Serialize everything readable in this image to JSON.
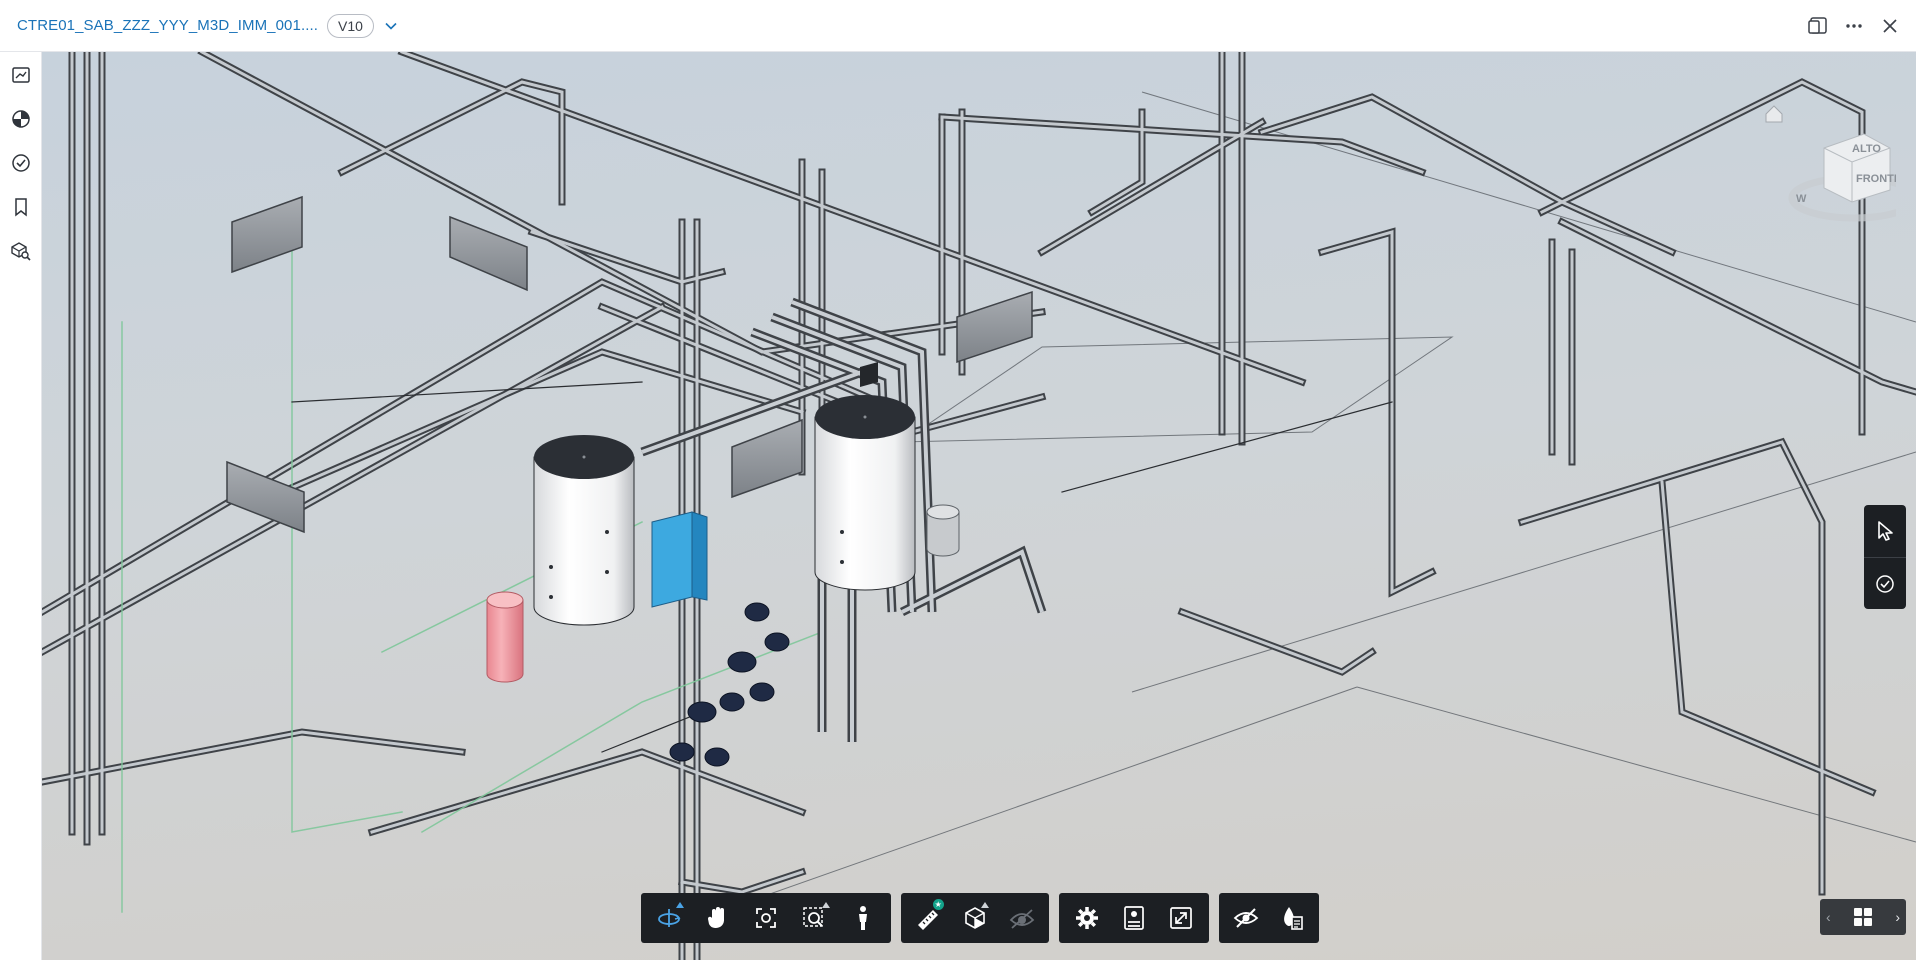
{
  "header": {
    "document_title": "CTRE01_SAB_ZZZ_YYY_M3D_IMM_001....",
    "version": "V10",
    "icons": [
      "version-dropdown-icon",
      "split-view-icon",
      "more-options-icon",
      "close-icon"
    ]
  },
  "left_rail": {
    "items": [
      {
        "name": "sheets-views",
        "icon": "sheets-icon"
      },
      {
        "name": "appearance",
        "icon": "palette-icon"
      },
      {
        "name": "issues",
        "icon": "check-circle-icon"
      },
      {
        "name": "bookmarks",
        "icon": "bookmark-icon"
      },
      {
        "name": "model-browser",
        "icon": "model-search-icon"
      }
    ]
  },
  "viewcube": {
    "top_label": "ALTO",
    "front_label": "FRONTE",
    "home_icon": "home-icon",
    "compass_label": "W"
  },
  "right_tools": {
    "items": [
      {
        "name": "select",
        "icon": "cursor-icon"
      },
      {
        "name": "markup-check",
        "icon": "check-circle-icon"
      }
    ]
  },
  "toolbar": {
    "groups": [
      {
        "name": "navigation",
        "items": [
          "orbit-icon",
          "pan-icon",
          "fit-view-icon",
          "zoom-window-icon",
          "first-person-icon"
        ]
      },
      {
        "name": "measure-section",
        "items": [
          "measure-icon",
          "section-box-icon",
          "explode-icon"
        ]
      },
      {
        "name": "settings",
        "items": [
          "settings-icon",
          "properties-icon",
          "fullscreen-icon"
        ]
      },
      {
        "name": "visibility",
        "items": [
          "hide-icon",
          "model-tree-icon"
        ]
      }
    ],
    "active_tool": "orbit-icon"
  },
  "pager": {
    "prev": "‹",
    "next": "›",
    "icon": "grid-icon"
  },
  "colors": {
    "accent": "#1a73b8",
    "toolbar_bg": "#1c1f23",
    "active_icon": "#4aa3e6",
    "badge": "#13a38b",
    "tank_red": "#f3a2a8",
    "heat_exchanger": "#3da9e0"
  }
}
